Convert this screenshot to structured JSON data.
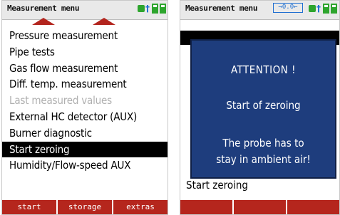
{
  "left_screen": {
    "title": "Measurement menu",
    "status_icons": [
      "battery-icon",
      "bluetooth-icon",
      "battery-icon"
    ],
    "menu_items": [
      {
        "label": "Pressure measurement",
        "state": "normal"
      },
      {
        "label": "Pipe tests",
        "state": "normal"
      },
      {
        "label": "Gas flow measurement",
        "state": "normal"
      },
      {
        "label": "Diff. temp. measurement",
        "state": "normal"
      },
      {
        "label": "Last measured values",
        "state": "disabled"
      },
      {
        "label": "External HC detector (AUX)",
        "state": "normal"
      },
      {
        "label": "Burner diagnostic",
        "state": "normal"
      },
      {
        "label": "Start zeroing",
        "state": "selected"
      },
      {
        "label": "Humidity/Flow-speed AUX",
        "state": "normal"
      }
    ],
    "softkeys": [
      "start",
      "storage",
      "extras"
    ]
  },
  "right_screen": {
    "title": "Measurement menu",
    "zero_badge": "→0.0←",
    "dialog": {
      "title": "ATTENTION !",
      "line1": "Start of zeroing",
      "line2a": "The probe has to",
      "line2b": "stay in ambient air!"
    },
    "behind_text": "Start zeroing"
  },
  "colors": {
    "softkey_bar": "#b5261d",
    "dialog_bg": "#1e3d7d",
    "status_green": "#2da52d",
    "status_blue": "#1f6fd1"
  }
}
